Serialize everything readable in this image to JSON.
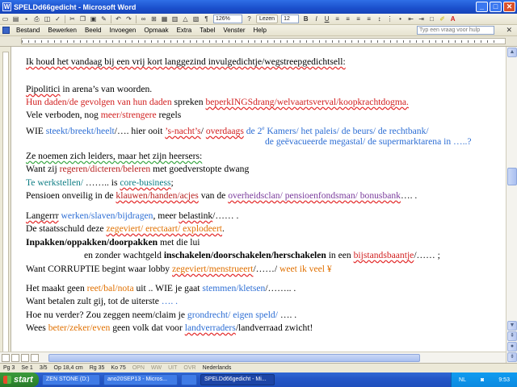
{
  "window": {
    "title": "SPELDd66gedicht - Microsoft Word"
  },
  "toolbar": {
    "zoom": "126%",
    "read_label": "Lezen",
    "font_size": "12"
  },
  "menu": {
    "items": [
      "Bestand",
      "Bewerken",
      "Beeld",
      "Invoegen",
      "Opmaak",
      "Extra",
      "Tabel",
      "Venster",
      "Help"
    ],
    "help_placeholder": "Typ een vraag voor hulp"
  },
  "document": {
    "lines": [
      {
        "segments": [
          {
            "t": "Ik houd het vandaag bij een vrij kort langgezind invulgedichtje/wegstreepgedichtsell:",
            "c": "",
            "sq": true
          }
        ]
      },
      {
        "segments": [
          {
            "t": "Pipolitici",
            "c": "",
            "sq": true
          },
          {
            "t": " in arena’s van woorden.",
            "c": ""
          }
        ]
      },
      {
        "segments": [
          {
            "t": "Hun daden/de gevolgen van hun daden",
            "c": "red"
          },
          {
            "t": " spreken ",
            "c": ""
          },
          {
            "t": "beperkINGSdrang/welvaartsverval/koopkrachtdogma.",
            "c": "red",
            "sq": true
          }
        ]
      },
      {
        "segments": [
          {
            "t": "Vele verboden, nog ",
            "c": ""
          },
          {
            "t": "meer/strengere",
            "c": "red"
          },
          {
            "t": " regels",
            "c": ""
          }
        ]
      },
      {
        "segments": [
          {
            "t": "WIE ",
            "c": ""
          },
          {
            "t": "steekt/breekt/heelt",
            "c": "blue"
          },
          {
            "t": "/…. hier ooit ",
            "c": ""
          },
          {
            "t": "’s-nacht’s",
            "c": "red",
            "sq": true
          },
          {
            "t": "/ ",
            "c": ""
          },
          {
            "t": "overdaags",
            "c": "red",
            "sq": true
          },
          {
            "t": " de 2",
            "c": "blue"
          },
          {
            "t": "e",
            "c": "blue",
            "sup": true
          },
          {
            "t": " Kamers/ het paleis/ de beurs/ de rechtbank/",
            "c": "blue"
          }
        ]
      },
      {
        "segments": [
          {
            "t": "de geëvacueerde megastal/ de supermarktarena in …..?",
            "c": "blue"
          }
        ]
      },
      {
        "segments": [
          {
            "t": "Ze noemen zich leiders, maar het zijn heersers:",
            "c": "",
            "gq": true
          }
        ]
      },
      {
        "segments": [
          {
            "t": "Want zij ",
            "c": ""
          },
          {
            "t": "regeren/dicteren/beleren",
            "c": "dkred"
          },
          {
            "t": " met goedverstopte dwang",
            "c": ""
          }
        ]
      },
      {
        "segments": [
          {
            "t": "Te werkstellen/",
            "c": "teal"
          },
          {
            "t": " …….. is ",
            "c": ""
          },
          {
            "t": "core-business",
            "c": "teal",
            "sq": true
          },
          {
            "t": ";",
            "c": ""
          }
        ]
      },
      {
        "segments": [
          {
            "t": "Pensioen onveilig in de ",
            "c": ""
          },
          {
            "t": "klauwen/handen/acjes",
            "c": "dkred",
            "sq": true
          },
          {
            "t": " van de ",
            "c": ""
          },
          {
            "t": "overheidsclan/ pensioenfondsman/ bonusbank",
            "c": "purple",
            "sq": true
          },
          {
            "t": "…. .",
            "c": ""
          }
        ]
      },
      {
        "segments": [
          {
            "t": "Langerrr",
            "c": "",
            "sq": true
          },
          {
            "t": " ",
            "c": ""
          },
          {
            "t": "werken/slaven/bijdragen",
            "c": "blue"
          },
          {
            "t": ", meer ",
            "c": ""
          },
          {
            "t": "belastink",
            "c": "",
            "sq": true
          },
          {
            "t": "/…… .",
            "c": ""
          }
        ]
      },
      {
        "segments": [
          {
            "t": "De staatsschuld deze ",
            "c": ""
          },
          {
            "t": "zegeviert/ erectaart/ explodeert",
            "c": "orange",
            "sq": true
          },
          {
            "t": ".",
            "c": ""
          }
        ]
      },
      {
        "segments": [
          {
            "t": "Inpakken/oppakken/doorpakken",
            "c": "",
            "b": true
          },
          {
            "t": " met die lui",
            "c": ""
          }
        ]
      },
      {
        "segments": [
          {
            "t": "en zonder wachtgeld ",
            "c": ""
          },
          {
            "t": "inschakelen/doorschakelen/herschakelen",
            "c": "",
            "b": true
          },
          {
            "t": " in een ",
            "c": ""
          },
          {
            "t": "bijstandsbaantje",
            "c": "red",
            "sq": true
          },
          {
            "t": "/…… ;",
            "c": ""
          }
        ]
      },
      {
        "segments": [
          {
            "t": "Want CORRUPTIE begint waar lobby ",
            "c": ""
          },
          {
            "t": "zegeviert/menstrueert",
            "c": "orange",
            "sq": true
          },
          {
            "t": "/……/ ",
            "c": ""
          },
          {
            "t": "weet ik veel ¥",
            "c": "orange"
          }
        ]
      },
      {
        "segments": [
          {
            "t": "Het maakt geen ",
            "c": ""
          },
          {
            "t": "reet/bal/nota",
            "c": "orange"
          },
          {
            "t": " uit .. WIE je gaat ",
            "c": ""
          },
          {
            "t": "stemmen/kletsen",
            "c": "blue"
          },
          {
            "t": "/…….. .",
            "c": ""
          }
        ]
      },
      {
        "segments": [
          {
            "t": "Want betalen zult gij, tot de uiterste ",
            "c": ""
          },
          {
            "t": "…. .",
            "c": "blue"
          }
        ]
      },
      {
        "segments": [
          {
            "t": "Hoe nu verder? Zou zeggen neem/claim je ",
            "c": ""
          },
          {
            "t": "grondrecht/ eigen speld/",
            "c": "blue"
          },
          {
            "t": " …. .",
            "c": ""
          }
        ]
      },
      {
        "segments": [
          {
            "t": "Wees ",
            "c": ""
          },
          {
            "t": "beter/zeker/even",
            "c": "orange"
          },
          {
            "t": " geen volk dat voor ",
            "c": ""
          },
          {
            "t": "landverraders",
            "c": "blue",
            "sq": true
          },
          {
            "t": "/landverraad zwicht!",
            "c": ""
          }
        ]
      }
    ]
  },
  "status": {
    "page": "Pg 3",
    "section": "Se 1",
    "pages": "3/5",
    "at": "Op 18,4 cm",
    "line": "Rg 35",
    "col": "Ko 75",
    "rec": "OPN",
    "trk": "WW",
    "ext": "UIT",
    "ovr": "OVR",
    "language": "Nederlands"
  },
  "taskbar": {
    "start": "start",
    "items": [
      "ZEN STONE (D:)",
      "ano20SEP13 - Micros...",
      "",
      "SPELDd66gedicht - Mi..."
    ],
    "lang": "NL",
    "clock": "9:53"
  },
  "colors": {
    "red": "#d11f1f",
    "orange": "#e07000",
    "blue": "#2d6ed4",
    "teal": "#0e7d84",
    "dkred": "#b8201f",
    "purple": "#7a3b9c"
  }
}
